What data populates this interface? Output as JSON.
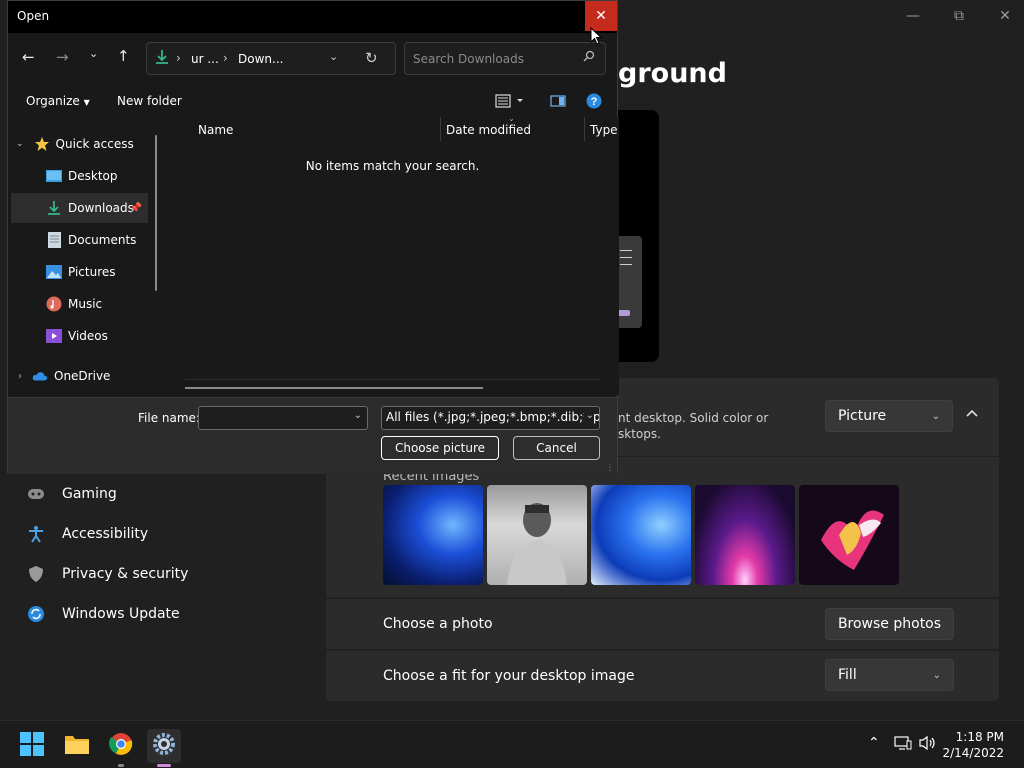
{
  "settings": {
    "title": "ground",
    "background_desc_line1": "nt desktop. Solid color or",
    "background_desc_line2": "sktops.",
    "background_type": "Picture",
    "recent_label": "Recent images",
    "choose_photo_label": "Choose a photo",
    "browse_photos_label": "Browse photos",
    "fit_label": "Choose a fit for your desktop image",
    "fit_value": "Fill",
    "nav": [
      {
        "label": "Gaming",
        "icon": "gaming-icon"
      },
      {
        "label": "Accessibility",
        "icon": "accessibility-icon"
      },
      {
        "label": "Privacy & security",
        "icon": "shield-icon"
      },
      {
        "label": "Windows Update",
        "icon": "update-icon"
      }
    ]
  },
  "dialog": {
    "title": "Open",
    "address_parts": [
      "ur ...",
      "Down..."
    ],
    "search_placeholder": "Search Downloads",
    "organize_label": "Organize",
    "new_folder_label": "New folder",
    "tree": [
      {
        "label": "Quick access",
        "icon": "star-icon"
      },
      {
        "label": "Desktop",
        "icon": "desktop-icon"
      },
      {
        "label": "Downloads",
        "icon": "download-icon"
      },
      {
        "label": "Documents",
        "icon": "document-icon"
      },
      {
        "label": "Pictures",
        "icon": "pictures-icon"
      },
      {
        "label": "Music",
        "icon": "music-icon"
      },
      {
        "label": "Videos",
        "icon": "videos-icon"
      },
      {
        "label": "OneDrive",
        "icon": "cloud-icon"
      }
    ],
    "columns": [
      "Name",
      "Date modified",
      "Type"
    ],
    "empty_message": "No items match your search.",
    "file_name_label": "File name:",
    "file_name_value": "",
    "file_type_value": "All files (*.jpg;*.jpeg;*.bmp;*.dib;*.png",
    "choose_button": "Choose picture",
    "cancel_button": "Cancel"
  },
  "taskbar": {
    "time": "1:18 PM",
    "date": "2/14/2022"
  },
  "colors": {
    "accent": "#0078d4",
    "close_red": "#c42b1c"
  }
}
